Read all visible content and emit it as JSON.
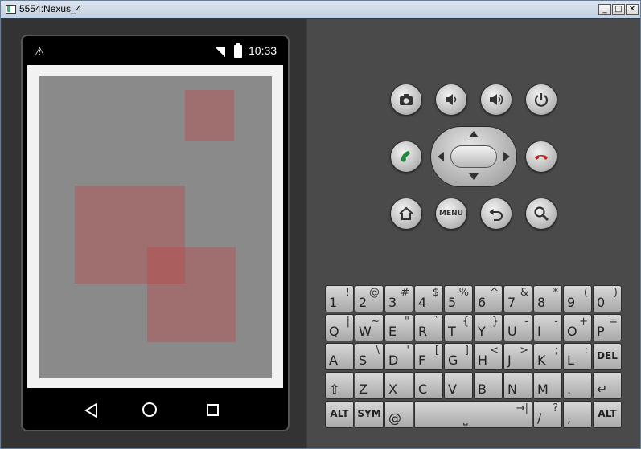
{
  "window": {
    "title": "5554:Nexus_4",
    "minimize": "_",
    "maximize": "□",
    "close": "✕"
  },
  "statusbar": {
    "warning_icon": "warning-icon",
    "time": "10:33"
  },
  "canvas": {
    "background": "#8a8a8a",
    "rect_color": "rgba(190,70,70,0.4)"
  },
  "hardware_buttons": {
    "camera": "camera-icon",
    "volume_down": "volume-down-icon",
    "volume_up": "volume-up-icon",
    "power": "power-icon",
    "call": "call-icon",
    "end_call": "end-call-icon",
    "home": "home-icon",
    "menu_label": "MENU",
    "back": "back-icon",
    "search": "search-icon"
  },
  "keyboard": {
    "rows": [
      [
        [
          "1",
          "!"
        ],
        [
          "2",
          "@"
        ],
        [
          "3",
          "#"
        ],
        [
          "4",
          "$"
        ],
        [
          "5",
          "%"
        ],
        [
          "6",
          "^"
        ],
        [
          "7",
          "&"
        ],
        [
          "8",
          "*"
        ],
        [
          "9",
          "("
        ],
        [
          "0",
          ")"
        ]
      ],
      [
        [
          "Q",
          "|"
        ],
        [
          "W",
          "~"
        ],
        [
          "E",
          "\""
        ],
        [
          "R",
          "`"
        ],
        [
          "T",
          "{"
        ],
        [
          "Y",
          "}"
        ],
        [
          "U",
          "-"
        ],
        [
          "I",
          "-"
        ],
        [
          "O",
          "+"
        ],
        [
          "P",
          "="
        ]
      ],
      [
        [
          "A",
          ""
        ],
        [
          "S",
          "\\"
        ],
        [
          "D",
          "'"
        ],
        [
          "F",
          "["
        ],
        [
          "G",
          "]"
        ],
        [
          "H",
          "<"
        ],
        [
          "J",
          ">"
        ],
        [
          "K",
          ";"
        ],
        [
          "L",
          ":"
        ],
        [
          "DEL",
          ""
        ]
      ],
      [
        [
          "⇧",
          ""
        ],
        [
          "Z",
          ""
        ],
        [
          "X",
          ""
        ],
        [
          "C",
          ""
        ],
        [
          "V",
          ""
        ],
        [
          "B",
          ""
        ],
        [
          "N",
          ""
        ],
        [
          "M",
          ""
        ],
        [
          ".",
          ""
        ],
        [
          "↵",
          ""
        ]
      ],
      [
        [
          "ALT",
          ""
        ],
        [
          "SYM",
          ""
        ],
        [
          "@",
          ""
        ],
        [
          "␣",
          "→|"
        ],
        [
          "/",
          "?"
        ],
        [
          ",",
          ""
        ],
        [
          "ALT",
          ""
        ]
      ]
    ]
  }
}
